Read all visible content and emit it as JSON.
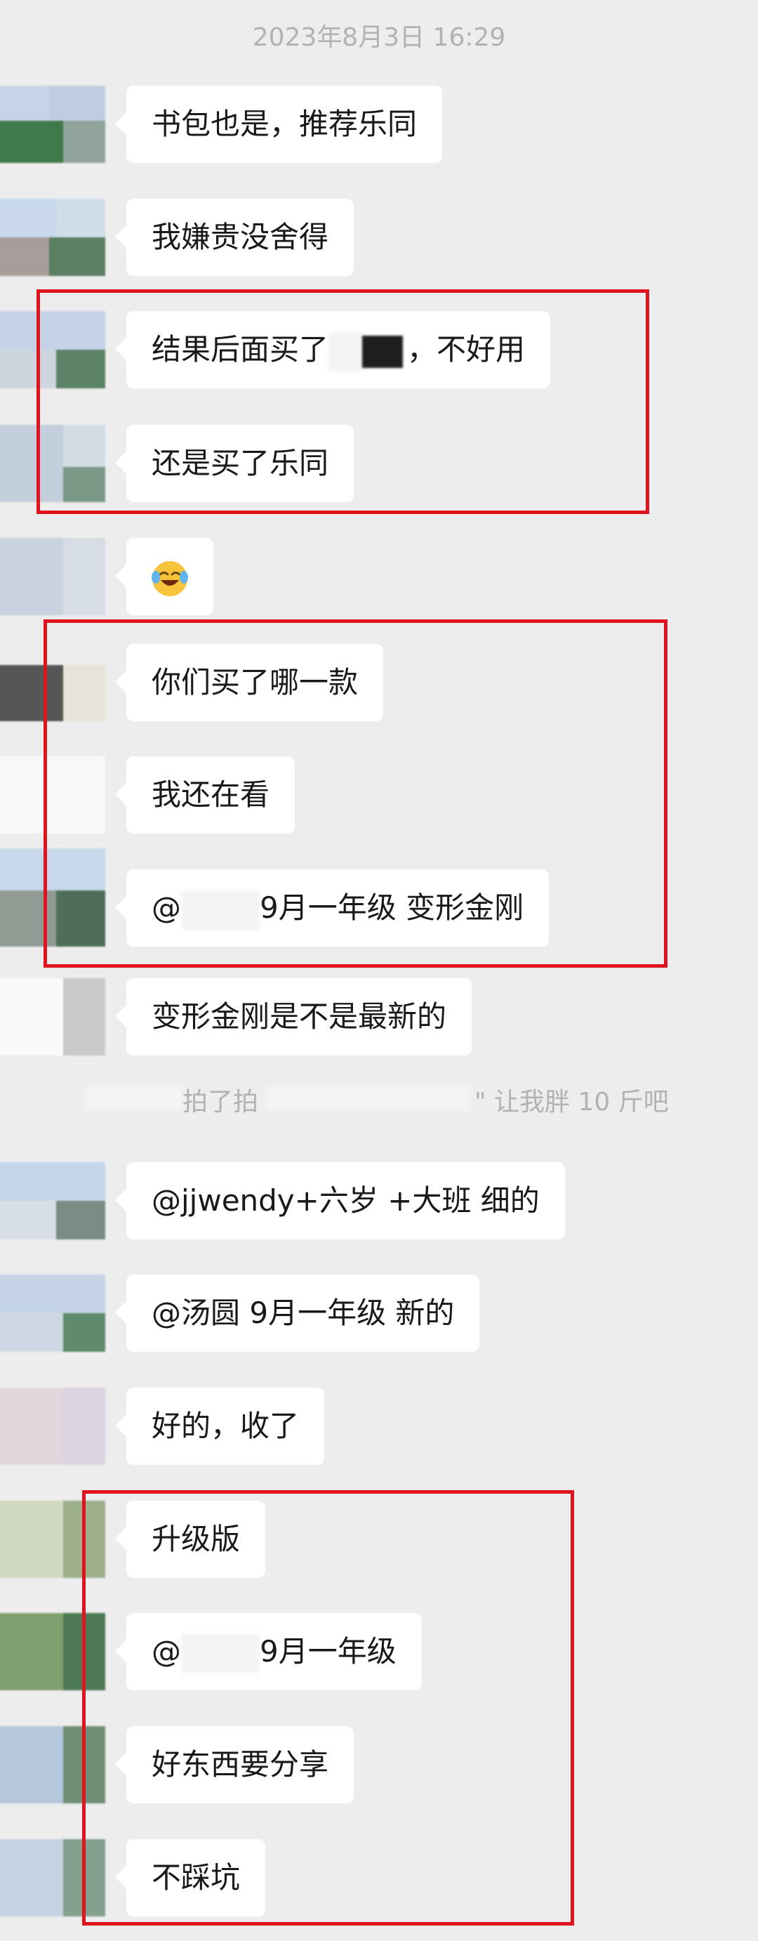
{
  "timestamp": "2023年8月3日 16:29",
  "messages": [
    {
      "text": "书包也是，推荐乐同"
    },
    {
      "text": "我嫌贵没舍得"
    },
    {
      "text_before": "结果后面买了",
      "text_after": "，不好用"
    },
    {
      "text": "还是买了乐同"
    },
    {
      "emoji": "crying-laughing-emoji"
    },
    {
      "text": "你们买了哪一款"
    },
    {
      "text": "我还在看"
    },
    {
      "mention_prefix": "@",
      "text_after": "9月一年级 变形金刚"
    },
    {
      "text": "变形金刚是不是最新的"
    },
    {
      "text": "@jjwendy+六岁 +大班 细的"
    },
    {
      "text": "@汤圆 9月一年级 新的"
    },
    {
      "text": "好的，收了"
    },
    {
      "text": "升级版"
    },
    {
      "mention_prefix": "@",
      "text_after": "9月一年级"
    },
    {
      "text": "好东西要分享"
    },
    {
      "text": "不踩坑"
    }
  ],
  "system_note": {
    "part1": "拍了拍",
    "part2": "\" 让我胖 10 斤吧"
  },
  "colors": {
    "background": "#ededed",
    "bubble": "#ffffff",
    "highlight": "#e0141e",
    "meta_text": "#b2b2b2"
  }
}
